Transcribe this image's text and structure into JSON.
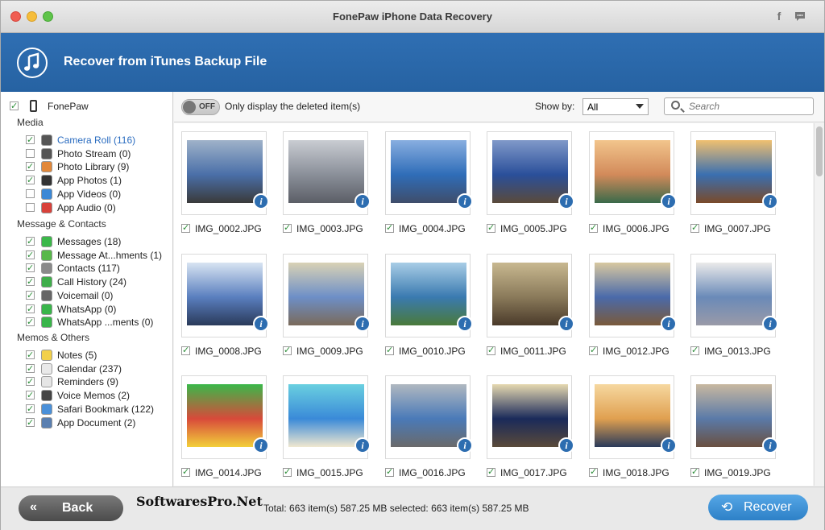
{
  "window": {
    "title": "FonePaw iPhone Data Recovery"
  },
  "header": {
    "title": "Recover from iTunes Backup File"
  },
  "sidebar": {
    "device": "FonePaw",
    "sections": [
      {
        "title": "Media",
        "items": [
          {
            "label": "Camera Roll (116)",
            "icon": "camera-icon",
            "checked": true,
            "selected": true
          },
          {
            "label": "Photo Stream (0)",
            "icon": "camera-icon",
            "checked": false
          },
          {
            "label": "Photo Library (9)",
            "icon": "photos-icon",
            "checked": true
          },
          {
            "label": "App Photos (1)",
            "icon": "app-photos-icon",
            "checked": true
          },
          {
            "label": "App Videos (0)",
            "icon": "app-videos-icon",
            "checked": false
          },
          {
            "label": "App Audio (0)",
            "icon": "music-icon",
            "checked": false
          }
        ]
      },
      {
        "title": "Message & Contacts",
        "items": [
          {
            "label": "Messages (18)",
            "icon": "messages-icon",
            "checked": true
          },
          {
            "label": "Message At...hments (1)",
            "icon": "attachment-icon",
            "checked": true
          },
          {
            "label": "Contacts (117)",
            "icon": "contacts-icon",
            "checked": true
          },
          {
            "label": "Call History (24)",
            "icon": "phone-icon",
            "checked": true
          },
          {
            "label": "Voicemail (0)",
            "icon": "voicemail-icon",
            "checked": true
          },
          {
            "label": "WhatsApp (0)",
            "icon": "whatsapp-icon",
            "checked": true
          },
          {
            "label": "WhatsApp ...ments (0)",
            "icon": "whatsapp-attachment-icon",
            "checked": true
          }
        ]
      },
      {
        "title": "Memos & Others",
        "items": [
          {
            "label": "Notes (5)",
            "icon": "notes-icon",
            "checked": true
          },
          {
            "label": "Calendar (237)",
            "icon": "calendar-icon",
            "checked": true
          },
          {
            "label": "Reminders (9)",
            "icon": "reminders-icon",
            "checked": true
          },
          {
            "label": "Voice Memos (2)",
            "icon": "voice-memos-icon",
            "checked": true
          },
          {
            "label": "Safari Bookmark (122)",
            "icon": "safari-icon",
            "checked": true
          },
          {
            "label": "App Document (2)",
            "icon": "document-icon",
            "checked": true
          }
        ]
      }
    ]
  },
  "toolbar": {
    "toggle_label": "OFF",
    "only_deleted_label": "Only display the deleted item(s)",
    "show_by_label": "Show by:",
    "show_by_value": "All",
    "search_placeholder": "Search"
  },
  "photos": [
    "IMG_0002.JPG",
    "IMG_0003.JPG",
    "IMG_0004.JPG",
    "IMG_0005.JPG",
    "IMG_0006.JPG",
    "IMG_0007.JPG",
    "IMG_0008.JPG",
    "IMG_0009.JPG",
    "IMG_0010.JPG",
    "IMG_0011.JPG",
    "IMG_0012.JPG",
    "IMG_0013.JPG",
    "IMG_0014.JPG",
    "IMG_0015.JPG",
    "IMG_0016.JPG",
    "IMG_0017.JPG",
    "IMG_0018.JPG",
    "IMG_0019.JPG"
  ],
  "footer": {
    "back_label": "Back",
    "watermark": "SoftwaresPro.Net",
    "totals": "Total: 663 item(s) 587.25 MB   selected: 663 item(s) 587.25 MB",
    "recover_label": "Recover"
  },
  "colors": {
    "accent": "#2a66a8",
    "check": "#2e8f3a",
    "recover": "#3d8fd6"
  }
}
